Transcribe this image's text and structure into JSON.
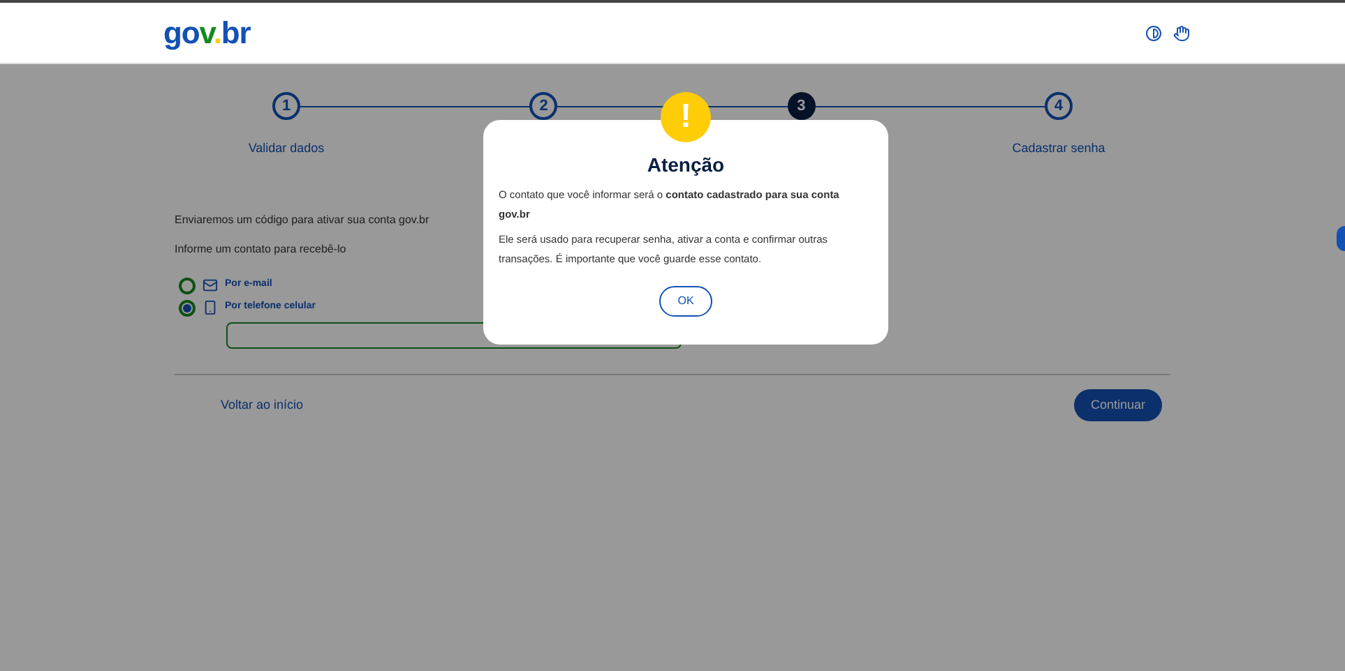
{
  "header": {
    "logo": "gov.br"
  },
  "steps": [
    {
      "number": "1",
      "label": "Validar dados",
      "selected": false
    },
    {
      "number": "2",
      "selected": false
    },
    {
      "number": "3",
      "selected": true
    },
    {
      "number": "4",
      "label": "Cadastrar senha",
      "selected": false
    }
  ],
  "intro": [
    "Enviaremos um código para ativar sua conta gov.br",
    "Informe um contato para recebê-lo"
  ],
  "options": [
    {
      "kind": "email",
      "label": "Por e-mail",
      "selected": false
    },
    {
      "kind": "phone",
      "label": "Por telefone celular",
      "selected": true
    }
  ],
  "footer": {
    "back_link": "Voltar ao início",
    "continue_button": "Continuar"
  },
  "modal": {
    "icon": "!",
    "title": "Atenção",
    "paragraphs": [
      "O contato que você informar será o **contato cadastrado para sua conta gov.br**",
      "Ele será usado para recuperar senha, ativar a conta e confirmar outras transações. É importante que você guarde esse contato."
    ],
    "button": "OK"
  }
}
